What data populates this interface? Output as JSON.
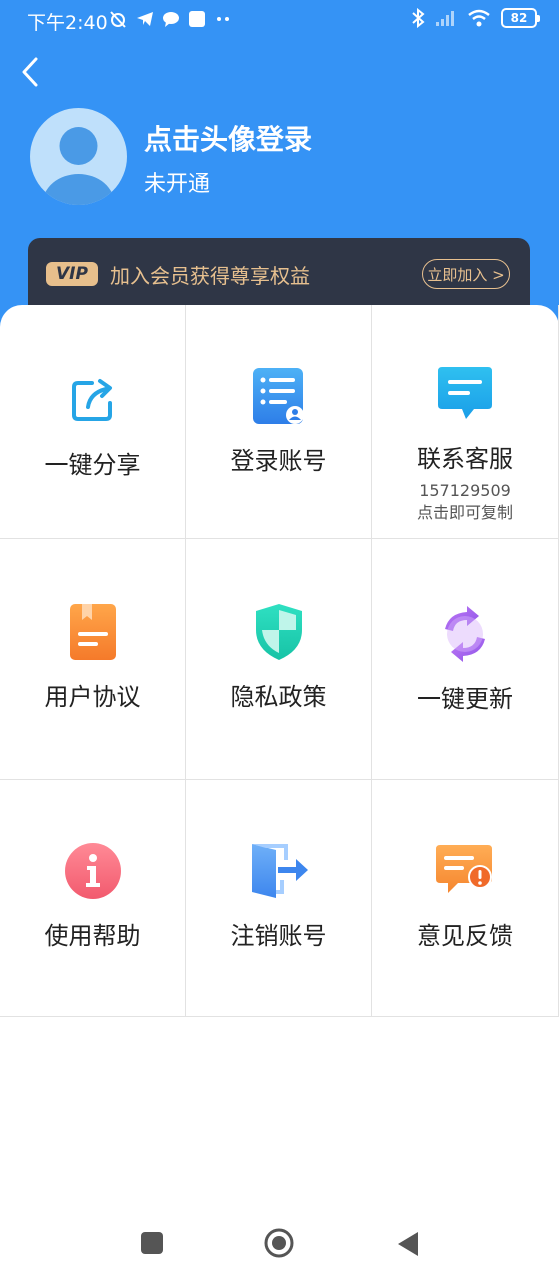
{
  "status": {
    "time": "下午2:40",
    "battery": "82"
  },
  "profile": {
    "title": "点击头像登录",
    "subtitle": "未开通"
  },
  "vip": {
    "badge": "VIP",
    "text": "加入会员获得尊享权益",
    "join": "立即加入 >"
  },
  "menu": [
    {
      "label": "一键分享",
      "icon": "share-icon"
    },
    {
      "label": "登录账号",
      "icon": "account-login-icon"
    },
    {
      "label": "联系客服",
      "sub1": "157129509",
      "sub2": "点击即可复制",
      "icon": "customer-service-icon"
    },
    {
      "label": "用户协议",
      "icon": "user-agreement-icon"
    },
    {
      "label": "隐私政策",
      "icon": "privacy-shield-icon"
    },
    {
      "label": "一键更新",
      "icon": "update-icon"
    },
    {
      "label": "使用帮助",
      "icon": "help-info-icon"
    },
    {
      "label": "注销账号",
      "icon": "logout-door-icon"
    },
    {
      "label": "意见反馈",
      "icon": "feedback-icon"
    }
  ],
  "colors": {
    "header": "#3593f5",
    "vip_bg": "#2f3646",
    "vip_gold": "#e7c08f"
  }
}
